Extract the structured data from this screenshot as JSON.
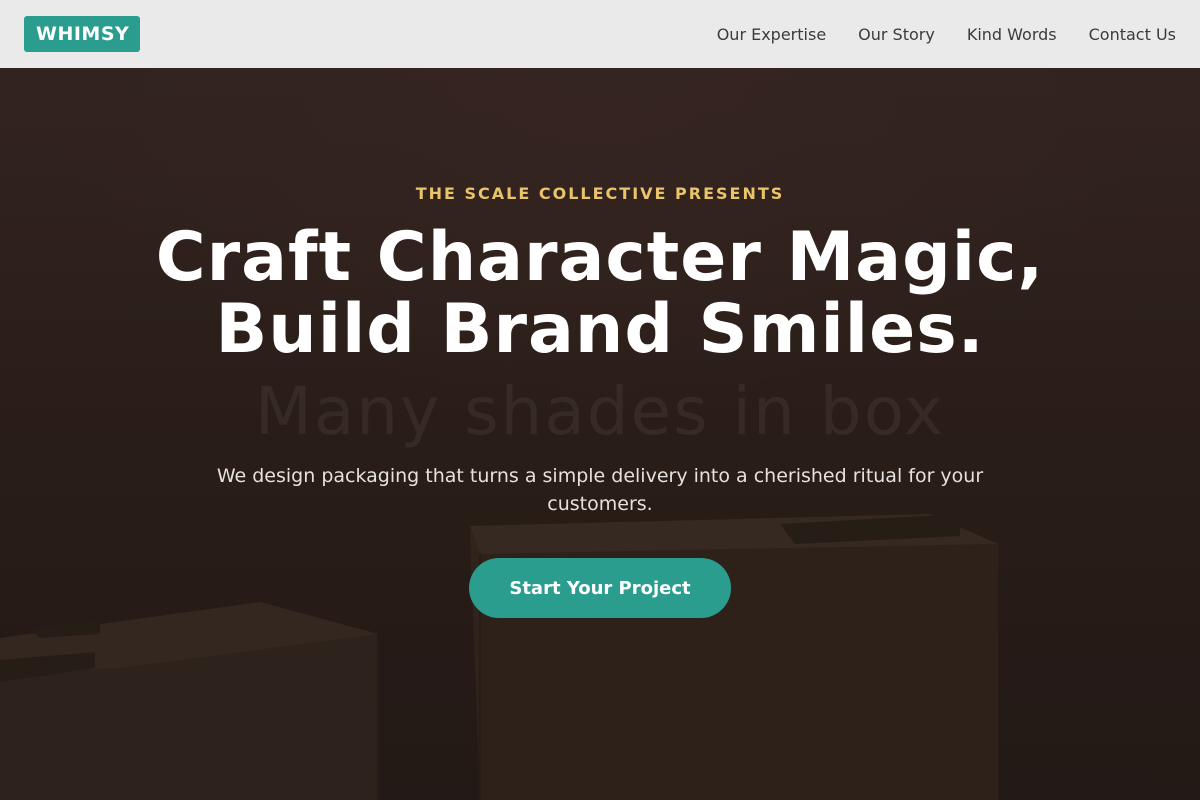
{
  "header": {
    "logo": "WHIMSY",
    "nav": [
      {
        "label": "Our Expertise"
      },
      {
        "label": "Our Story"
      },
      {
        "label": "Kind Words"
      },
      {
        "label": "Contact Us"
      }
    ]
  },
  "hero": {
    "eyebrow": "THE SCALE COLLECTIVE PRESENTS",
    "headline_line1": "Craft Character Magic,",
    "headline_line2": "Build Brand Smiles.",
    "subtitle": "We design packaging that turns a simple delivery into a cherished ritual for your customers.",
    "cta_label": "Start Your Project"
  },
  "colors": {
    "brand": "#2a9d8f",
    "accent": "#e9c46a",
    "header_bg": "#ebeaea",
    "hero_bg": "#2c211d"
  }
}
